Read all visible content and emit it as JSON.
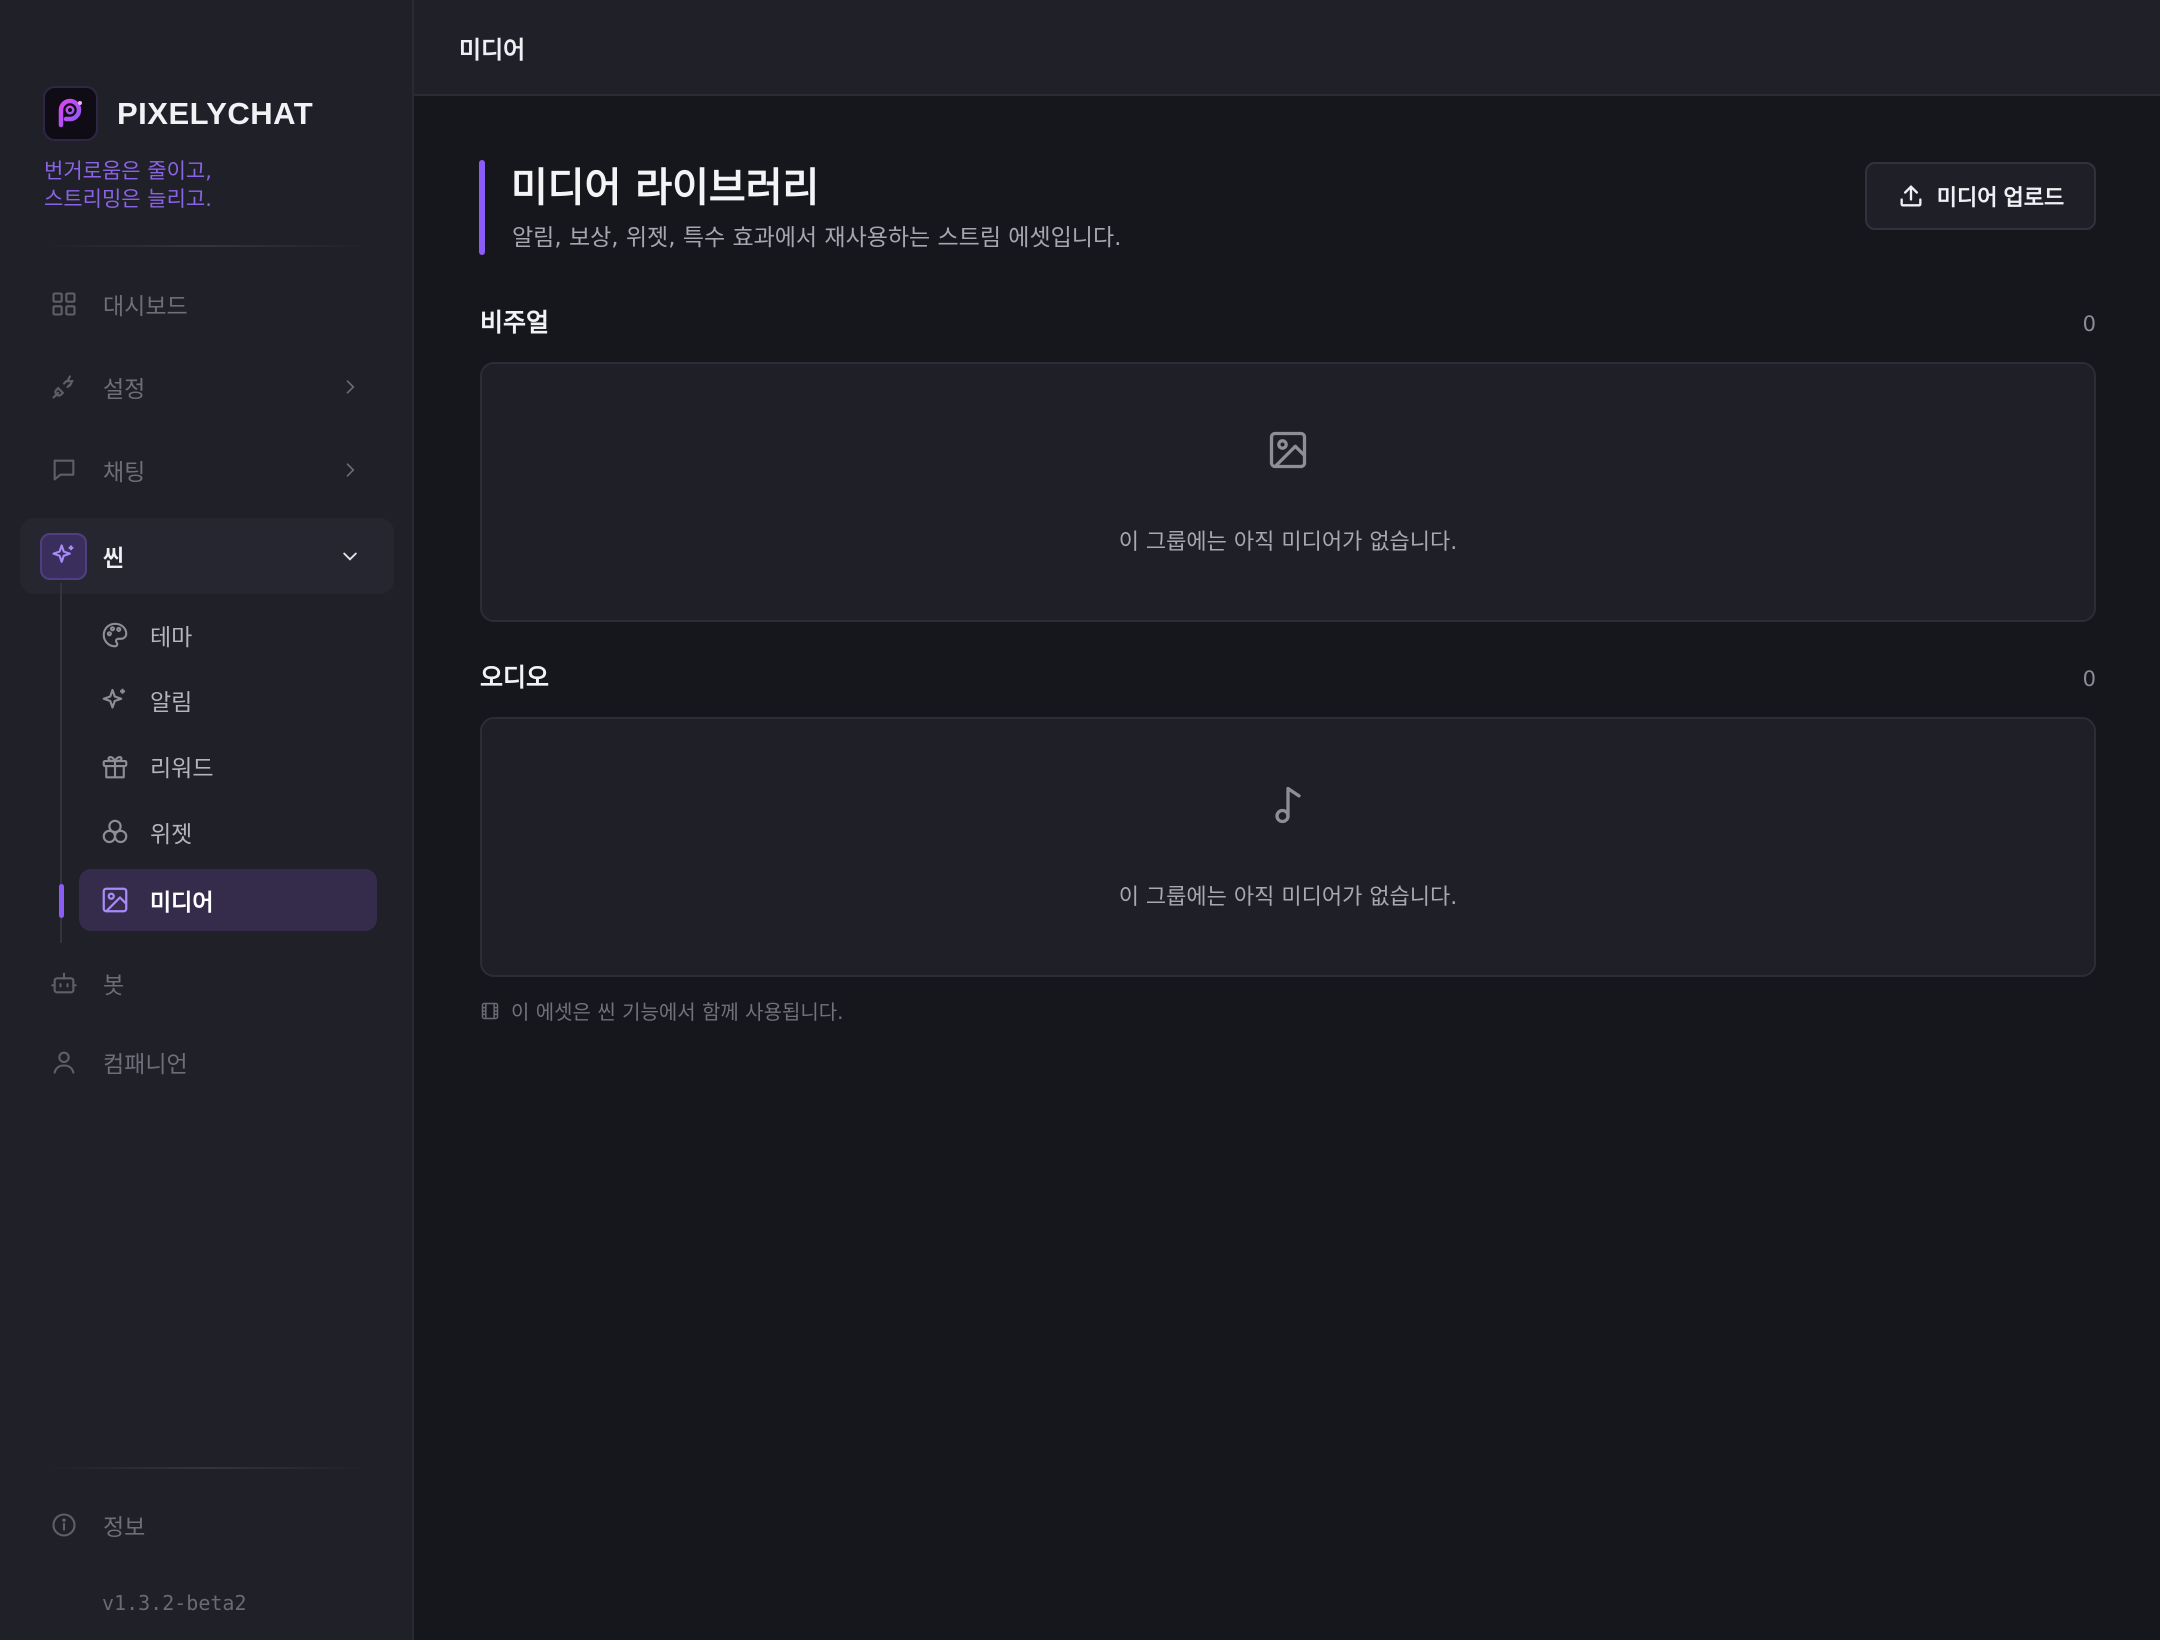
{
  "app": {
    "name": "PIXELYCHAT",
    "tagline_line1": "번거로움은 줄이고,",
    "tagline_line2": "스트리밍은 늘리고.",
    "version": "v1.3.2-beta2",
    "accent_color": "#8b5cf6"
  },
  "sidebar": {
    "items": [
      {
        "label": "대시보드",
        "icon": "grid-icon"
      },
      {
        "label": "설정",
        "icon": "plug-icon"
      },
      {
        "label": "채팅",
        "icon": "chat-icon"
      },
      {
        "label": "씬",
        "icon": "sparkles-icon",
        "expanded": true
      },
      {
        "label": "봇",
        "icon": "bot-icon"
      },
      {
        "label": "컴패니언",
        "icon": "user-icon"
      }
    ],
    "scene_children": [
      {
        "label": "테마",
        "icon": "palette-icon"
      },
      {
        "label": "알림",
        "icon": "sparkles-icon"
      },
      {
        "label": "리워드",
        "icon": "gift-icon"
      },
      {
        "label": "위젯",
        "icon": "circles-icon"
      },
      {
        "label": "미디어",
        "icon": "image-icon",
        "active": true
      }
    ],
    "info_label": "정보"
  },
  "topbar": {
    "title": "미디어"
  },
  "main": {
    "title": "미디어 라이브러리",
    "subtitle": "알림, 보상, 위젯, 특수 효과에서 재사용하는 스트림 에셋입니다.",
    "upload_label": "미디어 업로드",
    "groups": [
      {
        "title": "비주얼",
        "count": "0",
        "empty_text": "이 그룹에는 아직 미디어가 없습니다.",
        "icon": "image-icon"
      },
      {
        "title": "오디오",
        "count": "0",
        "empty_text": "이 그룹에는 아직 미디어가 없습니다.",
        "icon": "music-note-icon"
      }
    ],
    "footnote": "이 에셋은 씬 기능에서 함께 사용됩니다."
  }
}
